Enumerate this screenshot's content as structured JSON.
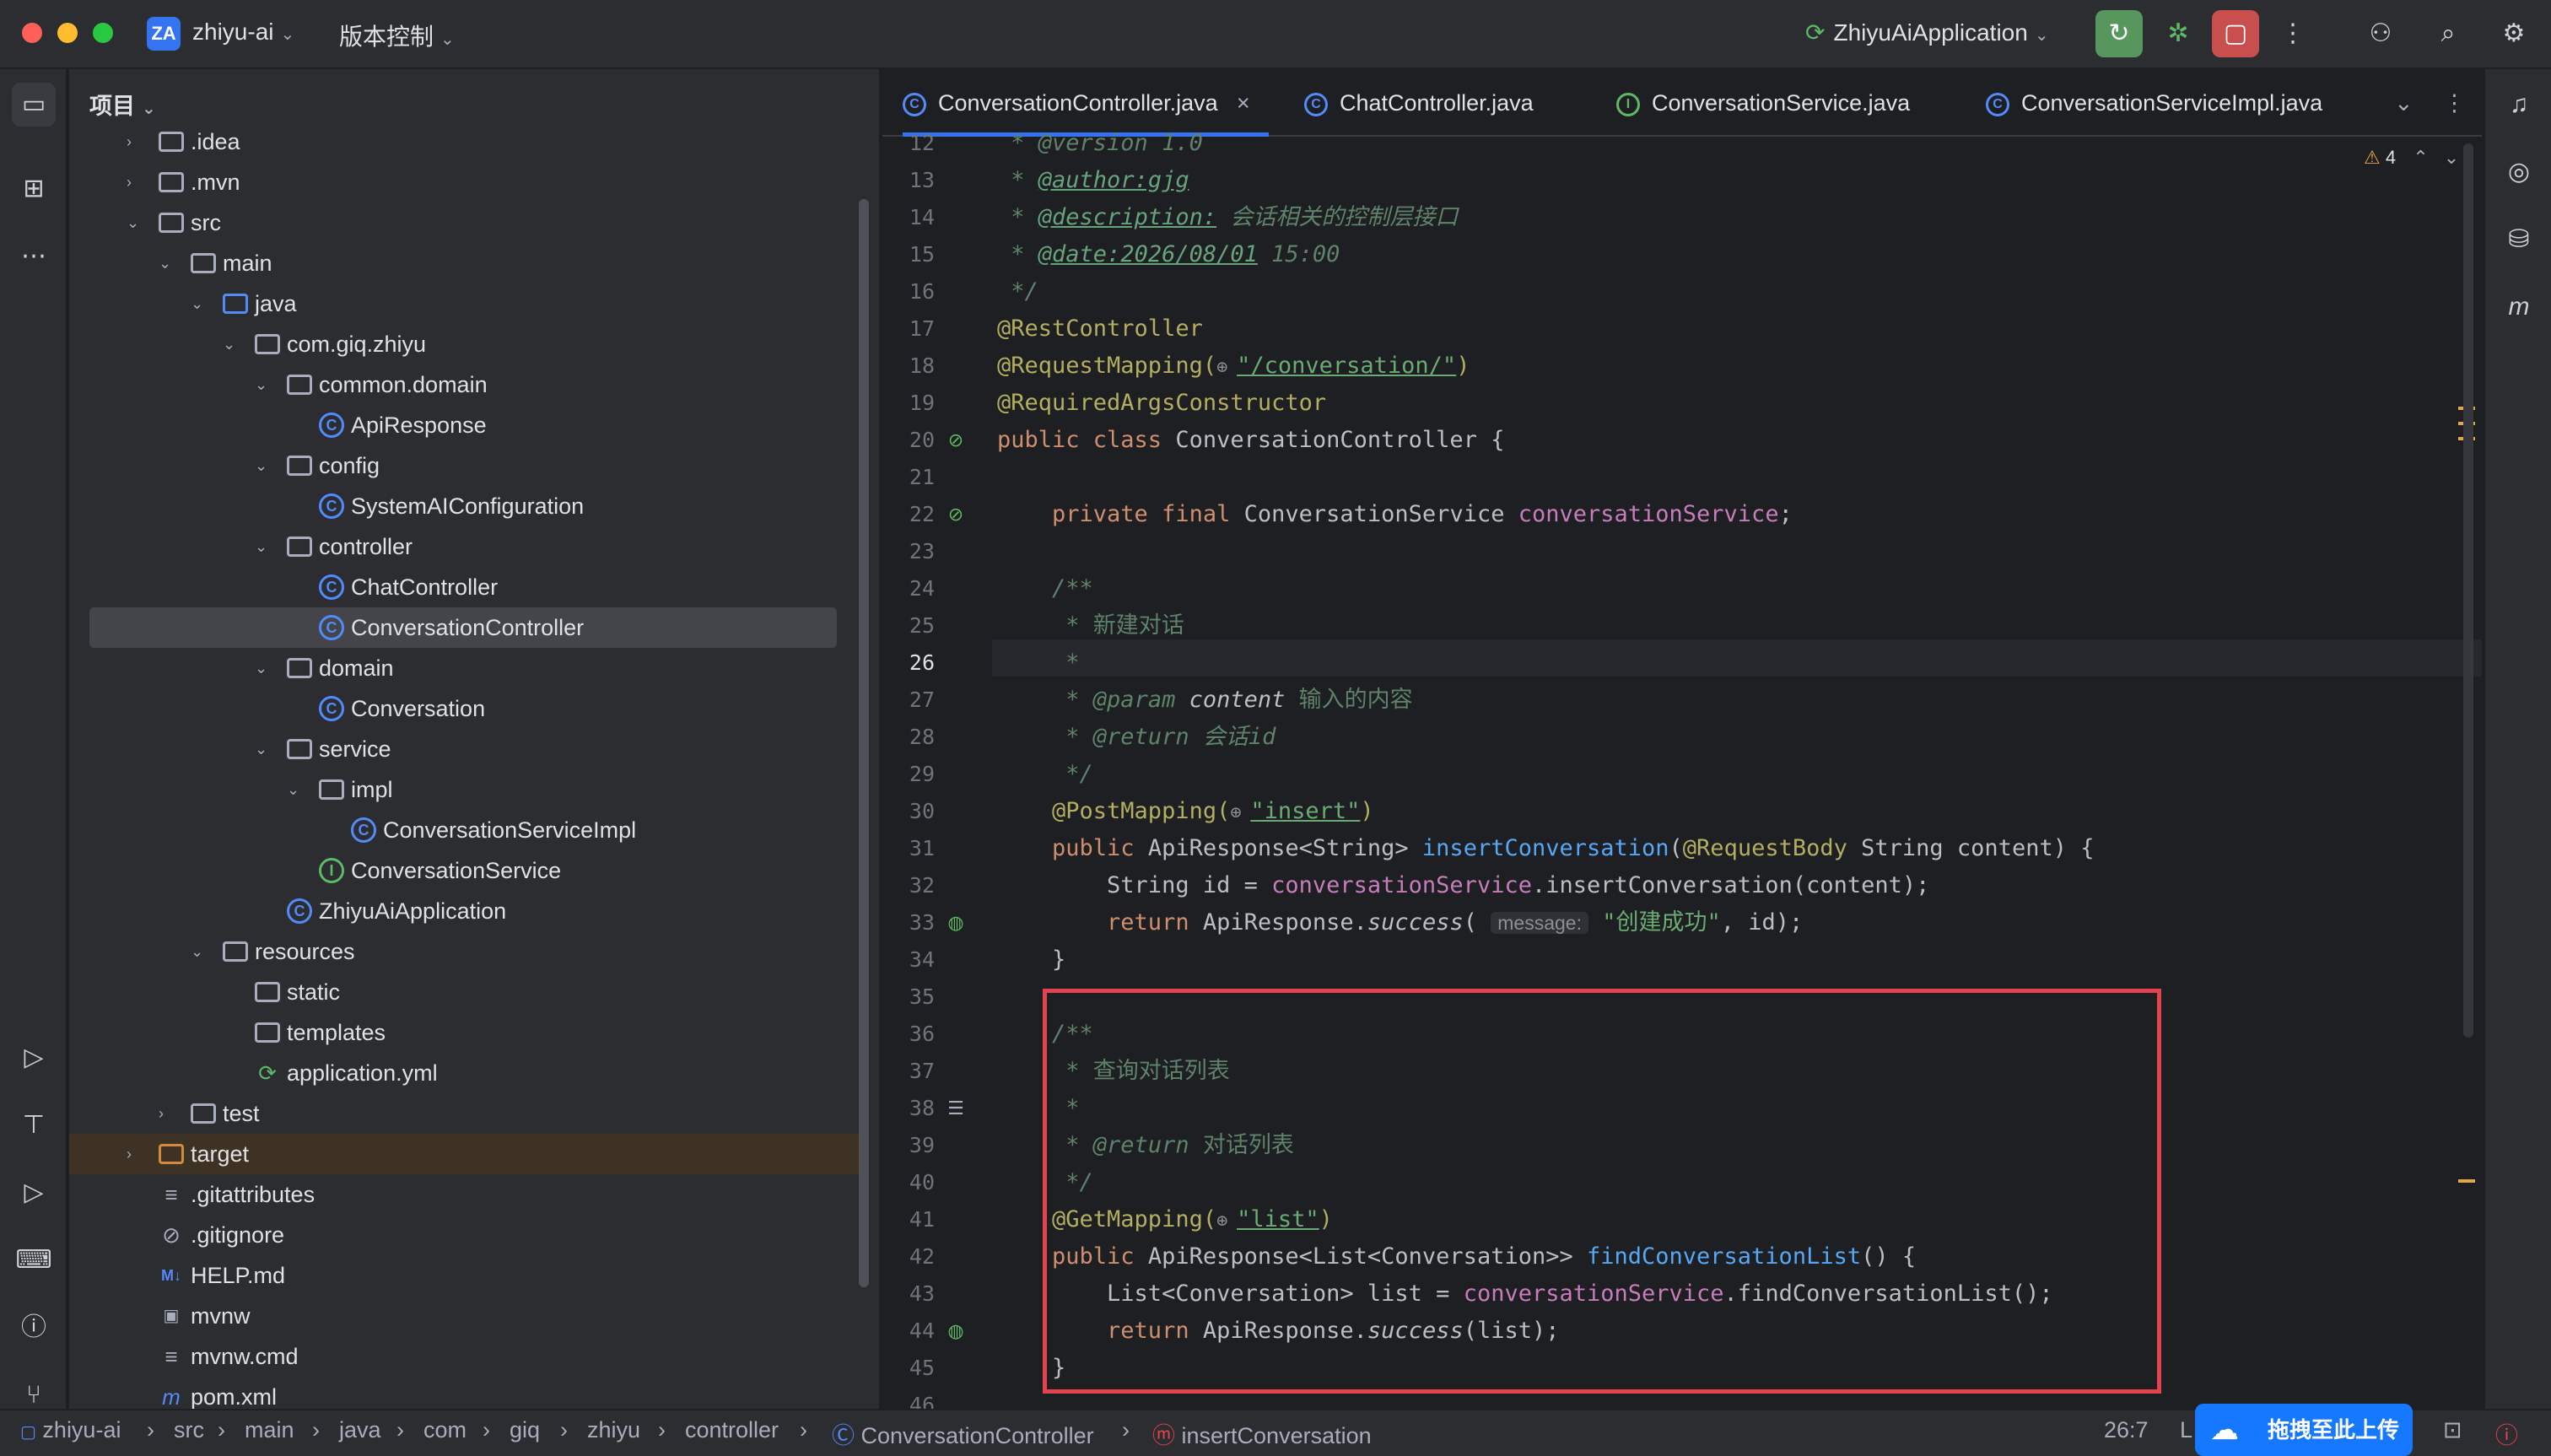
{
  "titlebar": {
    "project_badge": "ZA",
    "project_name": "zhiyu-ai",
    "vcs_label": "版本控制",
    "run_config": "ZhiyuAiApplication",
    "icons": [
      "run-reload-icon",
      "debug-icon",
      "stop-icon",
      "more-icon",
      "add-user-icon",
      "search-icon",
      "settings-icon"
    ]
  },
  "project_panel": {
    "title": "项目",
    "items": [
      {
        "label": ".idea",
        "kind": "folder"
      },
      {
        "label": ".mvn",
        "kind": "folder"
      },
      {
        "label": "src",
        "kind": "folder"
      },
      {
        "label": "main",
        "kind": "folder"
      },
      {
        "label": "java",
        "kind": "source-folder"
      },
      {
        "label": "com.giq.zhiyu",
        "kind": "package"
      },
      {
        "label": "common.domain",
        "kind": "package"
      },
      {
        "label": "ApiResponse",
        "kind": "class"
      },
      {
        "label": "config",
        "kind": "package"
      },
      {
        "label": "SystemAIConfiguration",
        "kind": "class"
      },
      {
        "label": "controller",
        "kind": "package"
      },
      {
        "label": "ChatController",
        "kind": "class"
      },
      {
        "label": "ConversationController",
        "kind": "class",
        "selected": true
      },
      {
        "label": "domain",
        "kind": "package"
      },
      {
        "label": "Conversation",
        "kind": "class"
      },
      {
        "label": "service",
        "kind": "package"
      },
      {
        "label": "impl",
        "kind": "package"
      },
      {
        "label": "ConversationServiceImpl",
        "kind": "class"
      },
      {
        "label": "ConversationService",
        "kind": "interface"
      },
      {
        "label": "ZhiyuAiApplication",
        "kind": "app-class"
      },
      {
        "label": "resources",
        "kind": "folder"
      },
      {
        "label": "static",
        "kind": "folder"
      },
      {
        "label": "templates",
        "kind": "folder"
      },
      {
        "label": "application.yml",
        "kind": "yaml-file"
      },
      {
        "label": "test",
        "kind": "folder"
      },
      {
        "label": "target",
        "kind": "excluded-folder"
      },
      {
        "label": ".gitattributes",
        "kind": "file"
      },
      {
        "label": ".gitignore",
        "kind": "ignore-file"
      },
      {
        "label": "HELP.md",
        "kind": "markdown-file"
      },
      {
        "label": "mvnw",
        "kind": "shell-file"
      },
      {
        "label": "mvnw.cmd",
        "kind": "file"
      },
      {
        "label": "pom.xml",
        "kind": "maven-file"
      }
    ]
  },
  "tabs": [
    {
      "label": "ConversationController.java",
      "icon": "C",
      "active": true
    },
    {
      "label": "ChatController.java",
      "icon": "C"
    },
    {
      "label": "ConversationService.java",
      "icon": "I"
    },
    {
      "label": "ConversationServiceImpl.java",
      "icon": "C"
    }
  ],
  "editor": {
    "warnings_count": "4",
    "line_numbers": [
      "12",
      "13",
      "14",
      "15",
      "16",
      "17",
      "18",
      "19",
      "20",
      "21",
      "22",
      "23",
      "24",
      "25",
      "26",
      "27",
      "28",
      "29",
      "30",
      "31",
      "32",
      "33",
      "34",
      "35",
      "36",
      "37",
      "38",
      "39",
      "40",
      "41",
      "42",
      "43",
      "44",
      "45",
      "46"
    ],
    "code": {
      "l12": " * @version 1.0",
      "l13a": " * ",
      "l13b": "@author:gjg",
      "l14a": " * ",
      "l14b": "@description:",
      "l14c": " 会话相关的控制层接口",
      "l15a": " * ",
      "l15b": "@date:2026/08/01",
      "l15c": " 15:00",
      "l16": " */",
      "l17": "@RestController",
      "l18a": "@RequestMapping(",
      "l18b": "\"/conversation/\"",
      "l18c": ")",
      "l19": "@RequiredArgsConstructor",
      "l20a": "public class ",
      "l20b": "ConversationController {",
      "l22a": "    private final ",
      "l22b": "ConversationService ",
      "l22c": "conversationService",
      "l22d": ";",
      "l24": "    /**",
      "l25": "     * 新建对话",
      "l26": "     *",
      "l27a": "     * ",
      "l27b": "@param",
      "l27c": " content",
      "l27d": " 输入的内容",
      "l28a": "     * ",
      "l28b": "@return",
      "l28c": " 会话id",
      "l29": "     */",
      "l30a": "    @PostMapping(",
      "l30b": "\"insert\"",
      "l30c": ")",
      "l31a": "    public ",
      "l31b": "ApiResponse<String> ",
      "l31c": "insertConversation",
      "l31d": "(",
      "l31e": "@RequestBody",
      "l31f": " String content) {",
      "l32a": "        String id = ",
      "l32b": "conversationService",
      "l32c": ".insertConversation(content);",
      "l33a": "        return ",
      "l33b": "ApiResponse.",
      "l33c": "success",
      "l33d": "(",
      "l33hint": "message:",
      "l33e": "\"创建成功\"",
      "l33f": ", id);",
      "l34": "    }",
      "l36": "    /**",
      "l37": "     * 查询对话列表",
      "l38": "     *",
      "l39a": "     * ",
      "l39b": "@return",
      "l39c": " 对话列表",
      "l40": "     */",
      "l41a": "    @GetMapping(",
      "l41b": "\"list\"",
      "l41c": ")",
      "l42a": "    public ",
      "l42b": "ApiResponse<List<Conversation>> ",
      "l42c": "findConversationList",
      "l42d": "() {",
      "l43a": "        List<Conversation> list = ",
      "l43b": "conversationService",
      "l43c": ".findConversationList();",
      "l44a": "        return ",
      "l44b": "ApiResponse.",
      "l44c": "success",
      "l44d": "(list);",
      "l45": "    }"
    }
  },
  "statusbar": {
    "breadcrumbs": [
      "zhiyu-ai",
      "src",
      "main",
      "java",
      "com",
      "giq",
      "zhiyu",
      "controller",
      "ConversationController",
      "insertConversation"
    ],
    "position": "26:7",
    "encoding_hint": "L",
    "upload_label": "拖拽至此上传"
  },
  "colors": {
    "accent": "#3574f0",
    "highlight_box": "#e5424f",
    "keyword": "#cf8e6d",
    "string": "#6aab73",
    "annotation": "#b3ae60",
    "field": "#c77dbb",
    "function": "#56a8f5",
    "doc_comment": "#5f826b"
  }
}
